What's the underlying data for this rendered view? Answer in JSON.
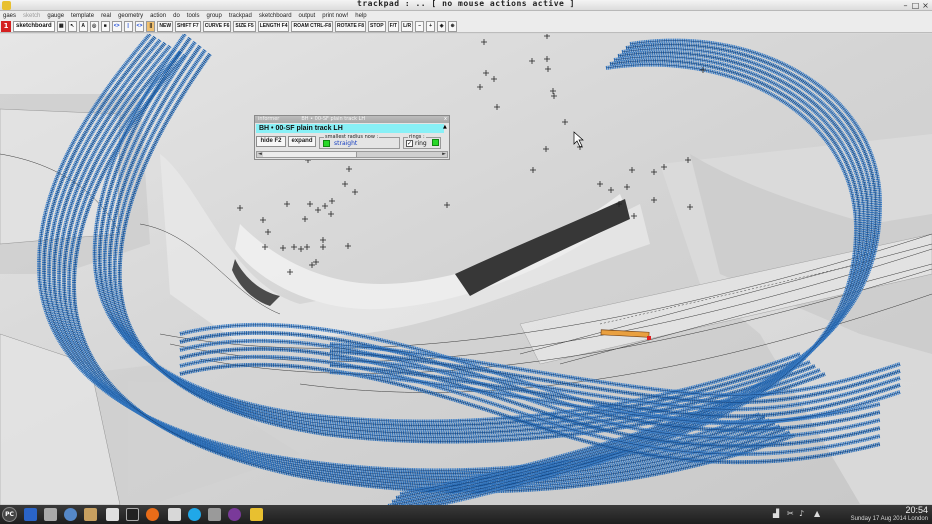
{
  "window": {
    "title": "trackpad :  ..  [ no mouse actions active ]",
    "min_glyph": "–",
    "max_glyph": "□",
    "close_glyph": "×"
  },
  "menu": [
    "gaes",
    "sketch",
    "gauge",
    "template",
    "real",
    "geometry",
    "action",
    "do",
    "tools",
    "group",
    "trackpad",
    "sketchboard",
    "output",
    "print now!",
    "help"
  ],
  "toolbar": {
    "badge": "1",
    "sketchboard_label": "sketchboard",
    "buttons": [
      "NEW",
      "SHIFT F7",
      "CURVE F6",
      "SIZE F5",
      "LENGTH F4",
      "ROAM CTRL-F8",
      "ROTATE F8",
      "STOP",
      "F/T",
      "L/R"
    ],
    "zoom": [
      "–",
      "+"
    ]
  },
  "informer": {
    "header_left": "informer",
    "header_right": "BH • 00-SF  plain track  LH",
    "close": "x",
    "template_name": "BH • 00-SF  plain track  LH",
    "hide_label": "hide  F2",
    "expand_label": "expand",
    "radius_legend": "smallest radius now :",
    "radius_value": "straight",
    "rings_legend": "rings :",
    "ring_label": "ring",
    "ring_checked": "✓"
  },
  "taskbar": {
    "start_label": "PC",
    "time": "20:54",
    "date": "Sunday 17 Aug 2014 London"
  },
  "colors": {
    "track": "#2a6cb4",
    "track_dark": "#103a70",
    "informer_name_bg": "#88f0f6",
    "badge": "#d42020"
  }
}
